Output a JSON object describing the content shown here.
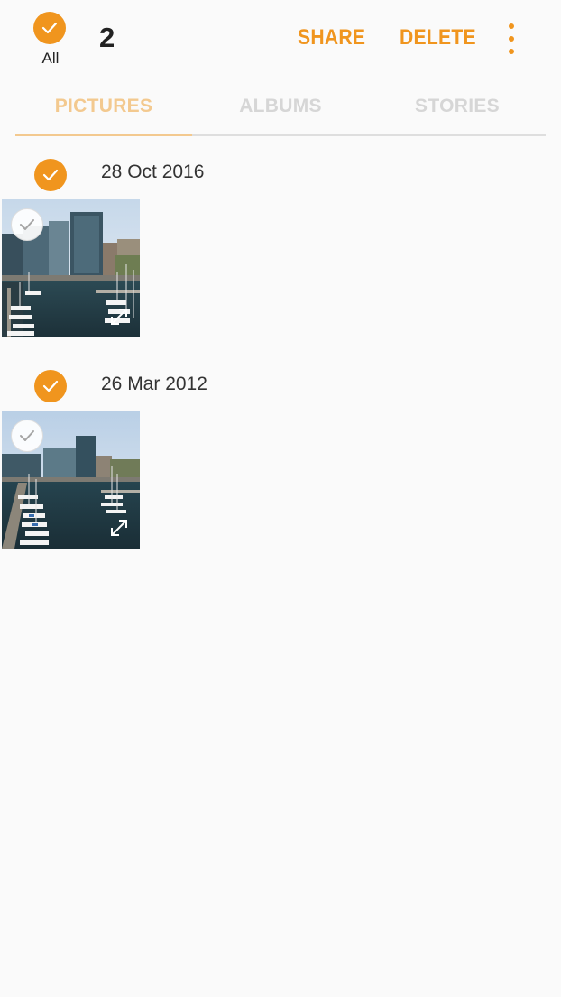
{
  "header": {
    "select_all_label": "All",
    "selected_count": "2",
    "share_label": "SHARE",
    "delete_label": "DELETE",
    "more_icon": "more-vertical-icon"
  },
  "tabs": [
    {
      "label": "PICTURES",
      "active": true
    },
    {
      "label": "ALBUMS",
      "active": false
    },
    {
      "label": "STORIES",
      "active": false
    }
  ],
  "groups": [
    {
      "date": "28 Oct 2016",
      "selected": true,
      "items": [
        {
          "selected": false,
          "type": "photo"
        }
      ]
    },
    {
      "date": "26 Mar 2012",
      "selected": true,
      "items": [
        {
          "selected": false,
          "type": "photo"
        }
      ]
    }
  ],
  "colors": {
    "accent": "#f0951e",
    "tab_active": "#f3c98f",
    "tab_inactive": "#d6d6d6",
    "background": "#fafafa"
  }
}
